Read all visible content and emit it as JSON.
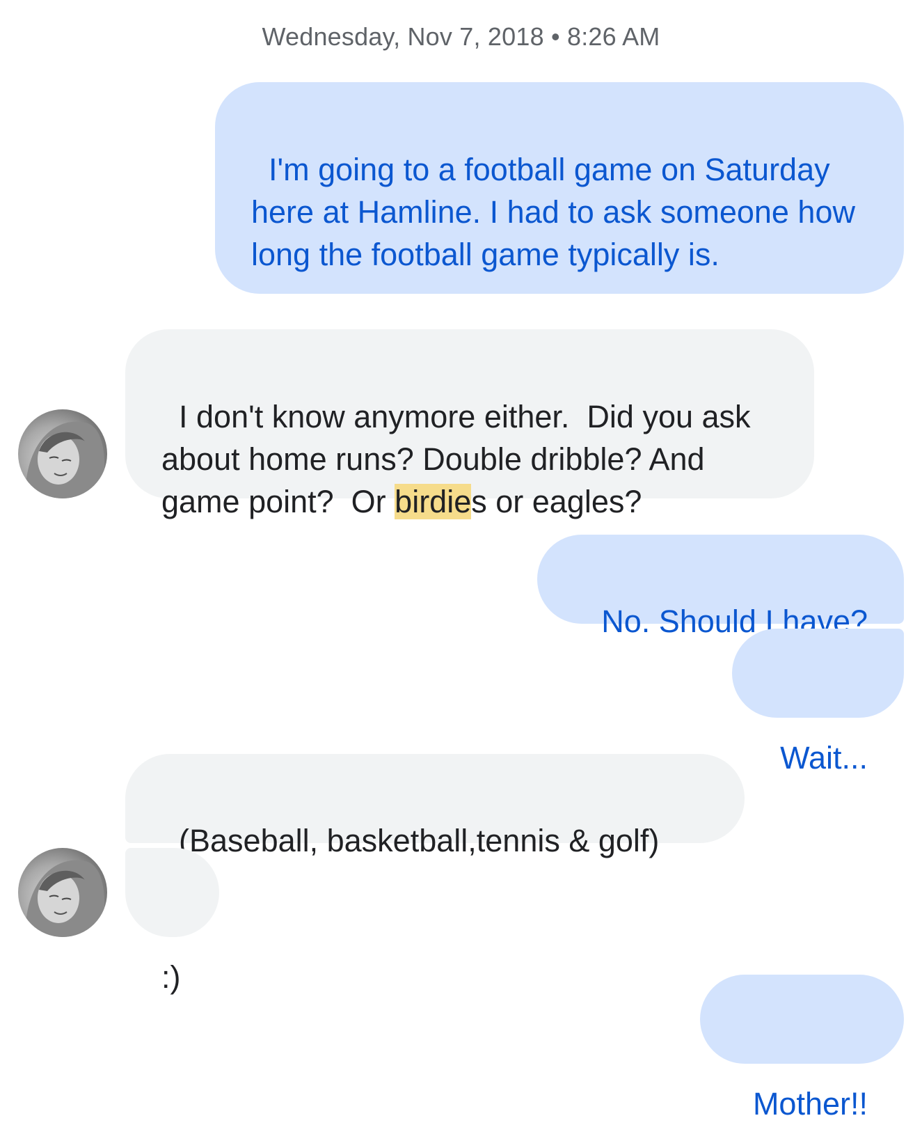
{
  "conversation": {
    "timestamp": "Wednesday, Nov 7, 2018 • 8:26 AM",
    "messages": [
      {
        "direction": "outgoing",
        "text": "I'm going to a football game on Saturday here at Hamline. I had to ask someone how long the football game typically is."
      },
      {
        "direction": "incoming",
        "text_before": "I don't know anymore either.  Did you ask about home runs? Double dribble? And game point?  Or ",
        "highlight": "birdie",
        "text_after": "s or eagles?"
      },
      {
        "direction": "outgoing",
        "text": "No. Should I have?"
      },
      {
        "direction": "outgoing",
        "text": "Wait..."
      },
      {
        "direction": "incoming",
        "text": "(Baseball, basketball,tennis & golf)"
      },
      {
        "direction": "incoming",
        "text": ":)"
      },
      {
        "direction": "outgoing",
        "text": "Mother!!"
      }
    ]
  },
  "colors": {
    "outgoing_bubble": "#d3e3fd",
    "outgoing_text": "#0b57d0",
    "incoming_bubble": "#f1f3f4",
    "incoming_text": "#202124",
    "highlight": "#f6dc8b",
    "timestamp_text": "#5f6368"
  }
}
